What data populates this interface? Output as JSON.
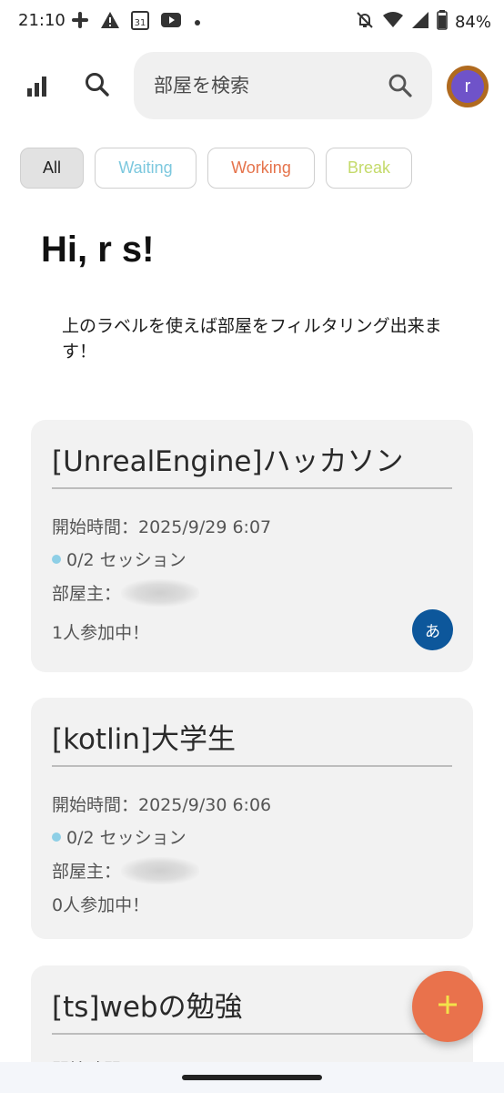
{
  "status_bar": {
    "time": "21:10",
    "left_icons": [
      "slack-icon",
      "warning-icon",
      "calendar-icon",
      "youtube-icon",
      "dot-icon"
    ],
    "calendar_day": "31",
    "right_icons": [
      "notifications-off-icon",
      "wifi-icon",
      "signal-icon",
      "battery-icon"
    ],
    "battery": "84%"
  },
  "app_bar": {
    "stats_icon": "bar-chart-icon",
    "search_icon": "search-icon",
    "search": {
      "placeholder": "部屋を検索",
      "value": ""
    },
    "avatar_letter": "r"
  },
  "filters": [
    {
      "label": "All",
      "selected": true,
      "color": "#1f1f1f"
    },
    {
      "label": "Waiting",
      "selected": false,
      "color": "#7cc8de"
    },
    {
      "label": "Working",
      "selected": false,
      "color": "#e5734b"
    },
    {
      "label": "Break",
      "selected": false,
      "color": "#c4da6a"
    }
  ],
  "greeting": "Hi, r s!",
  "hint": "上のラベルを使えば部屋をフィルタリング出来ます！",
  "rooms": [
    {
      "title": "[UnrealEngine]ハッカソン",
      "start_time": "開始時間：2025/9/29 6:07",
      "sessions": "0/2 セッション",
      "owner_label": "部屋主：",
      "participants": "1人参加中！",
      "member_initial": "あ"
    },
    {
      "title": "[kotlin]大学生",
      "start_time": "開始時間：2025/9/30 6:06",
      "sessions": "0/2 セッション",
      "owner_label": "部屋主：",
      "participants": "0人参加中！"
    },
    {
      "title": "[ts]webの勉強",
      "start_time": "開始時間："
    }
  ],
  "fab_icon": "plus-icon",
  "colors": {
    "accent": "#e9724c",
    "card": "#f2f2f2",
    "session_dot": "#8ecfe6",
    "member_avatar": "#0d579b"
  }
}
